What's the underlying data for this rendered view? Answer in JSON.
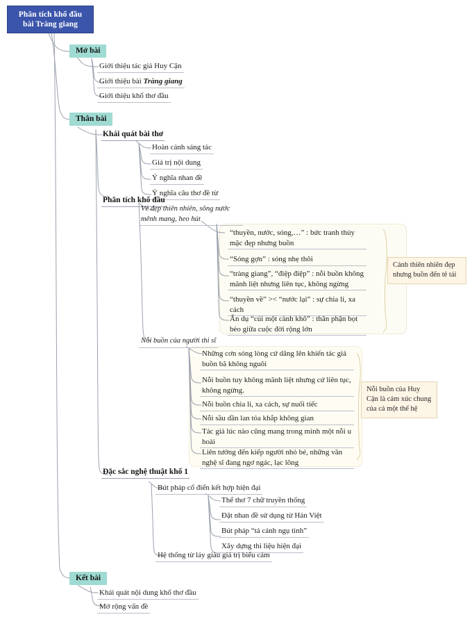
{
  "title": "Phân tích khổ đầu bài Tràng giang - sơ đồ tư duy",
  "colors": {
    "root_fill": "#3b55ab",
    "root_text": "#ffffff",
    "level1_fill": "#9fdbd2",
    "callout_fill": "#fdf5e6",
    "callout_border": "#e3d4b0",
    "line": "#9aa0ad",
    "panel_fill": "#fdfcf4"
  },
  "root": {
    "line1": "Phân tích khổ đầu",
    "line2": "bài Tràng giang"
  },
  "branches": [
    {
      "id": "mo-bai",
      "label": "Mở bài"
    },
    {
      "id": "than-bai",
      "label": "Thân bài"
    },
    {
      "id": "ket-bai",
      "label": "Kết bài"
    }
  ],
  "mo_bai": {
    "label": "Mở bài",
    "items": [
      {
        "text": "Giới thiệu tác giả Huy Cận"
      },
      {
        "pre": "Giới thiệu bài ",
        "em": "Tràng giang",
        "post": ""
      },
      {
        "text": "Giới thiệu khổ thơ đầu"
      }
    ]
  },
  "than_bai": {
    "label": "Thân bài",
    "khai_quat": {
      "label": "Khái quát bài thơ",
      "items": [
        "Hoàn cảnh sáng tác",
        "Giá trị nội dung",
        "Ý nghĩa nhan đề",
        "Ý nghĩa câu thơ đề từ"
      ]
    },
    "phan_tich": {
      "label": "Phân tích khổ đầu",
      "group1": {
        "heading": "Vẻ đẹp thiên nhiên, sông nước mênh mang, heo hút",
        "items": [
          "“thuyền, nước, sóng,…” : bức tranh thủy mặc đẹp nhưng buồn",
          "“Sóng gợn” : sóng nhẹ thôi",
          "“tràng giang”, “điệp điệp” : nỗi buồn không mãnh liệt nhưng liên tục, không ngừng",
          "“thuyền về” >< “nước lại” : sự chia li, xa cách",
          "Ẩn dụ “củi một cành khô” : thân phận bọt bèo giữa cuộc đời rộng lớn"
        ],
        "callout": "Cảnh thiên nhiên đẹp nhưng buồn đến tê tái"
      },
      "group2": {
        "heading": "Nỗi buồn của người thi sĩ",
        "items": [
          "Những cơn sóng lòng cứ dâng lên khiến tác giả buồn bã không nguôi",
          "Nỗi buồn tuy không mãnh liệt nhưng cứ liên tục, không ngừng.",
          "Nỗi buồn chia li, xa cách, sự nuối tiếc",
          "Nỗi sầu dần lan tỏa khắp không gian",
          "Tác giả lúc nào cũng mang trong mình một nỗi u hoài",
          "Liên tưởng đến kiếp người nhỏ bé, những văn nghệ sĩ đang ngơ ngác, lạc lõng"
        ],
        "callout": "Nỗi buồn của Huy Cận là cảm xúc chung của cả một thế hệ"
      }
    },
    "dac_sac": {
      "label": "Đặc sắc nghệ thuật khổ 1",
      "items": [
        "Bút pháp cổ điển kết hợp hiện đại",
        "Hệ thống từ láy giàu giá trị biểu cảm"
      ],
      "sub_items": [
        "Thể thơ 7 chữ truyền thống",
        "Đặt nhan đề sử dụng từ Hán Việt",
        "Bút pháp “tả cảnh ngụ tình”",
        "Xây dựng thi liệu hiện đại"
      ]
    }
  },
  "ket_bai": {
    "label": "Kết bài",
    "items": [
      "Khái quát nội dung khổ thơ đầu",
      "Mở rộng vấn đề"
    ]
  }
}
